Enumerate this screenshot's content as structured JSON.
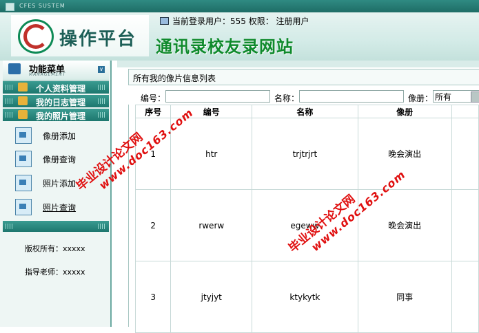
{
  "window": {
    "system_label": "CFES SUSTEM"
  },
  "header": {
    "platform_title": "操作平台",
    "user_line": "当前登录用户：555  权限：  注册用户",
    "site_title": "通讯录校友录网站"
  },
  "sidebar": {
    "menu_title": "功能菜单",
    "menu_subtitle": "MANAGEMENT",
    "categories": [
      {
        "label": "个人资料管理"
      },
      {
        "label": "我的日志管理"
      },
      {
        "label": "我的照片管理"
      }
    ],
    "items": [
      {
        "label": "像册添加"
      },
      {
        "label": "像册查询"
      },
      {
        "label": "照片添加"
      },
      {
        "label": "照片查询"
      }
    ],
    "copyright": "版权所有：xxxxx",
    "advisor": "指导老师：xxxxx"
  },
  "main": {
    "panel_title": "所有我的像片信息列表",
    "search": {
      "number_label": "编号：",
      "name_label": "名称：",
      "album_label": "像册：",
      "album_selected": "所有",
      "number_value": "",
      "name_value": ""
    },
    "table": {
      "columns": [
        "序号",
        "编号",
        "名称",
        "像册"
      ],
      "rows": [
        {
          "index": "1",
          "code": "htr",
          "name": "trjtrjrt",
          "album": "晚会演出"
        },
        {
          "index": "2",
          "code": "rwerw",
          "name": "egeww",
          "album": "晚会演出"
        },
        {
          "index": "3",
          "code": "jtyjyt",
          "name": "ktykytk",
          "album": "同事"
        }
      ]
    }
  },
  "watermarks": [
    {
      "text": "毕业设计论文网",
      "url": "www.doc163.com"
    },
    {
      "text": "毕业设计论文网",
      "url": "www.doc163.com"
    }
  ]
}
